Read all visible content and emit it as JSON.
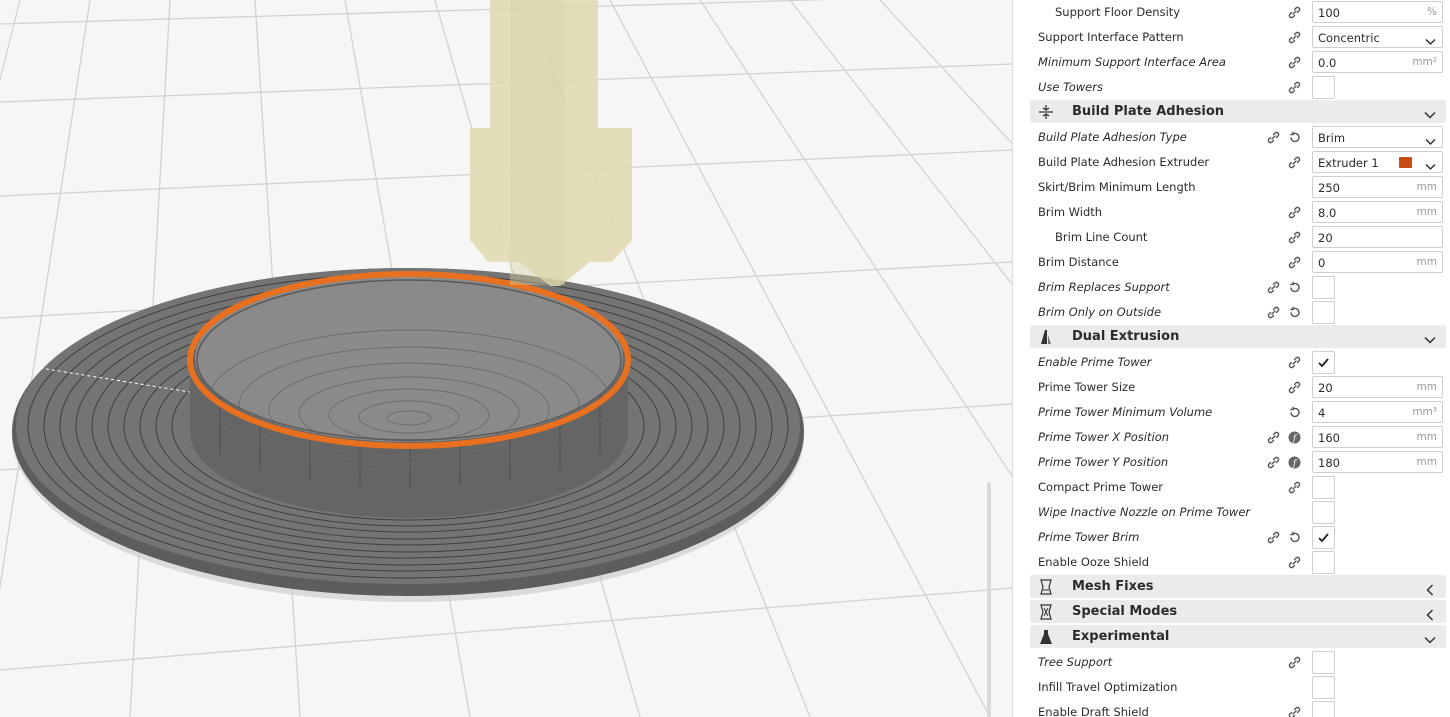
{
  "settings": {
    "support_floor_density": {
      "label": "Support Floor Density",
      "value": "100",
      "unit": "%"
    },
    "support_interface_pattern": {
      "label": "Support Interface Pattern",
      "value": "Concentric"
    },
    "min_support_interface_area": {
      "label": "Minimum Support Interface Area",
      "value": "0.0",
      "unit": "mm²"
    },
    "use_towers": {
      "label": "Use Towers",
      "checked": false
    },
    "build_plate_adhesion": {
      "title": "Build Plate Adhesion"
    },
    "adhesion_type": {
      "label": "Build Plate Adhesion Type",
      "value": "Brim"
    },
    "adhesion_extruder": {
      "label": "Build Plate Adhesion Extruder",
      "value": "Extruder 1",
      "swatch_color": "#c94c14"
    },
    "skirt_brim_min_length": {
      "label": "Skirt/Brim Minimum Length",
      "value": "250",
      "unit": "mm"
    },
    "brim_width": {
      "label": "Brim Width",
      "value": "8.0",
      "unit": "mm"
    },
    "brim_line_count": {
      "label": "Brim Line Count",
      "value": "20"
    },
    "brim_distance": {
      "label": "Brim Distance",
      "value": "0",
      "unit": "mm"
    },
    "brim_replaces_support": {
      "label": "Brim Replaces Support",
      "checked": false
    },
    "brim_only_outside": {
      "label": "Brim Only on Outside",
      "checked": false
    },
    "dual_extrusion": {
      "title": "Dual Extrusion"
    },
    "enable_prime_tower": {
      "label": "Enable Prime Tower",
      "checked": true
    },
    "prime_tower_size": {
      "label": "Prime Tower Size",
      "value": "20",
      "unit": "mm"
    },
    "prime_tower_min_volume": {
      "label": "Prime Tower Minimum Volume",
      "value": "4",
      "unit": "mm³"
    },
    "prime_tower_x": {
      "label": "Prime Tower X Position",
      "value": "160",
      "unit": "mm"
    },
    "prime_tower_y": {
      "label": "Prime Tower Y Position",
      "value": "180",
      "unit": "mm"
    },
    "compact_prime_tower": {
      "label": "Compact Prime Tower",
      "checked": false
    },
    "wipe_inactive_nozzle": {
      "label": "Wipe Inactive Nozzle on Prime Tower",
      "checked": false
    },
    "prime_tower_brim": {
      "label": "Prime Tower Brim",
      "checked": true
    },
    "enable_ooze_shield": {
      "label": "Enable Ooze Shield",
      "checked": false
    },
    "mesh_fixes": {
      "title": "Mesh Fixes"
    },
    "special_modes": {
      "title": "Special Modes"
    },
    "experimental": {
      "title": "Experimental"
    },
    "tree_support": {
      "label": "Tree Support",
      "checked": false
    },
    "infill_travel_optimization": {
      "label": "Infill Travel Optimization",
      "checked": false
    },
    "enable_draft_shield": {
      "label": "Enable Draft Shield",
      "checked": false
    }
  },
  "colors": {
    "accent": "#e8701f",
    "nozzle": "#e0d9b0",
    "model_gray": "#6e6e6e"
  }
}
